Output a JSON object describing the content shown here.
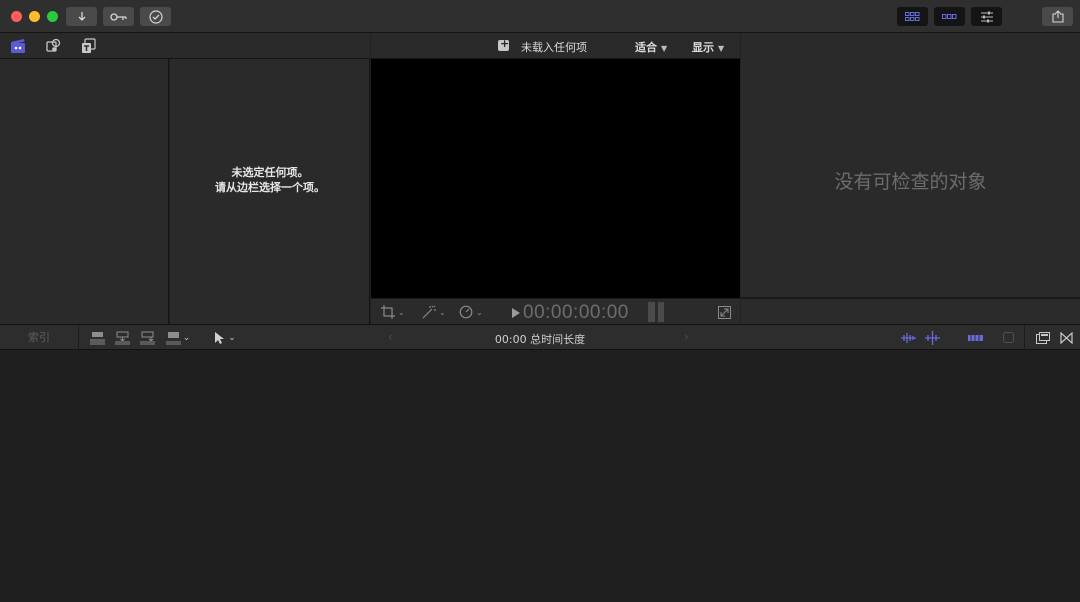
{
  "titlebar": {
    "buttons": [
      "import-icon",
      "keyword-icon",
      "checkmark-icon"
    ],
    "view_toggles": [
      "browser-toggle-icon",
      "timeline-toggle-icon",
      "inspector-toggle-icon"
    ],
    "share_icon": "share-icon"
  },
  "library_header": {
    "icons": [
      "libraries-icon",
      "photos-audio-icon",
      "titles-generators-icon"
    ]
  },
  "browser": {
    "empty_line1": "未选定任何项。",
    "empty_line2": "请从边栏选择一个项。"
  },
  "viewer": {
    "title": "未载入任何项",
    "fit_menu": "适合",
    "display_menu": "显示",
    "timecode": "00:00:00:00"
  },
  "inspector": {
    "empty_text": "没有可检查的对象"
  },
  "timeline_toolbar": {
    "index_label": "索引",
    "duration": "00:00 总时间长度"
  },
  "colors": {
    "accent": "#5b5bd6",
    "window_bg": "#222222",
    "viewer_bg": "#000000"
  }
}
